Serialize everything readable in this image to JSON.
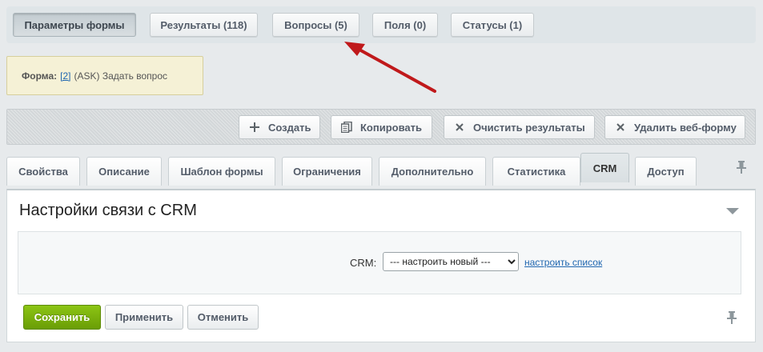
{
  "top_nav": {
    "items": [
      {
        "label": "Параметры формы",
        "active": true
      },
      {
        "label": "Результаты (118)",
        "active": false
      },
      {
        "label": "Вопросы (5)",
        "active": false
      },
      {
        "label": "Поля (0)",
        "active": false
      },
      {
        "label": "Статусы (1)",
        "active": false
      }
    ]
  },
  "form_info": {
    "label": "Форма:",
    "id_link": "[2]",
    "name": "(ASK) Задать вопрос"
  },
  "toolbar": {
    "create": {
      "label": "Создать",
      "icon": "plus-icon"
    },
    "copy": {
      "label": "Копировать",
      "icon": "copy-icon"
    },
    "clear": {
      "label": "Очистить результаты",
      "icon": "close-icon"
    },
    "delete": {
      "label": "Удалить веб-форму",
      "icon": "close-icon"
    }
  },
  "tabs": [
    {
      "label": "Свойства",
      "active": false
    },
    {
      "label": "Описание",
      "active": false
    },
    {
      "label": "Шаблон формы",
      "active": false
    },
    {
      "label": "Ограничения",
      "active": false
    },
    {
      "label": "Дополнительно",
      "active": false
    },
    {
      "label": "Статистика",
      "active": false
    },
    {
      "label": "CRM",
      "active": true
    },
    {
      "label": "Доступ",
      "active": false
    }
  ],
  "panel": {
    "title": "Настройки связи с CRM",
    "crm_label": "CRM:",
    "crm_select_value": "--- настроить новый ---",
    "crm_link": "настроить список"
  },
  "footer": {
    "save": "Сохранить",
    "apply": "Применить",
    "cancel": "Отменить"
  },
  "colors": {
    "arrow": "#c0191b",
    "save_button": "#7ab20e",
    "link": "#2067b0",
    "info_bg": "#f5f1d6"
  }
}
